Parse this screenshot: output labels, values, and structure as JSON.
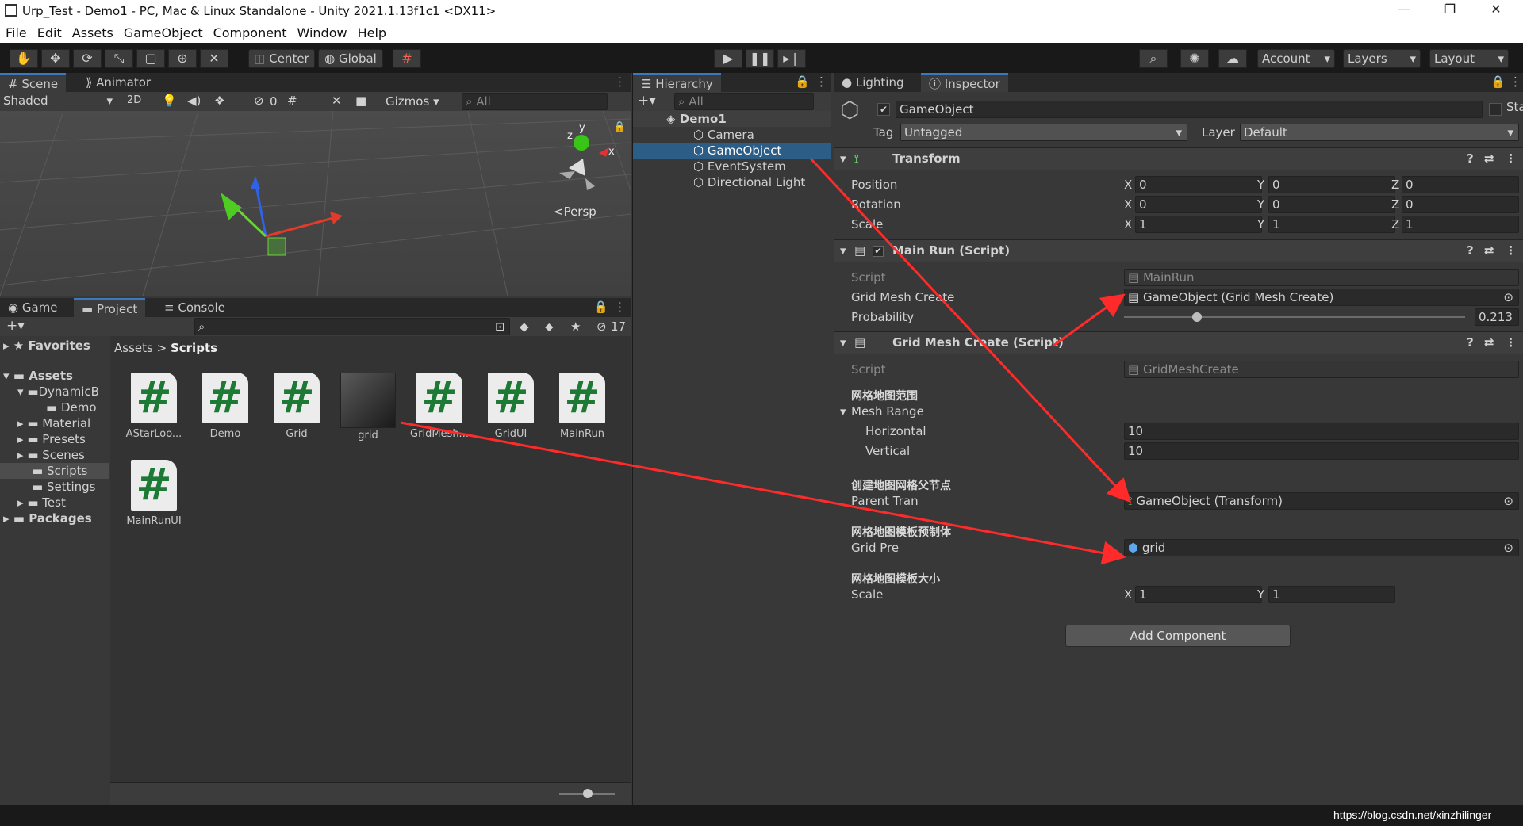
{
  "window": {
    "title": "Urp_Test - Demo1 - PC, Mac & Linux Standalone - Unity 2021.1.13f1c1 <DX11>",
    "minimize": "—",
    "maximize": "❐",
    "close": "✕"
  },
  "menu": [
    "File",
    "Edit",
    "Assets",
    "GameObject",
    "Component",
    "Window",
    "Help"
  ],
  "toolbar": {
    "center": "Center",
    "global": "Global",
    "account": "Account",
    "layers": "Layers",
    "layout": "Layout"
  },
  "scene": {
    "tab_scene": "Scene",
    "tab_animator": "Animator",
    "shaded": "Shaded",
    "mode_2d": "2D",
    "hidden_count": "0",
    "gizmos": "Gizmos",
    "search_placeholder": "All",
    "persp": "<Persp",
    "gizmo_x": "x",
    "gizmo_y": "y",
    "gizmo_z": "z"
  },
  "project": {
    "tab_game": "Game",
    "tab_project": "Project",
    "tab_console": "Console",
    "hidden_count": "17",
    "favorites": "Favorites",
    "assets": "Assets",
    "tree": [
      "DynamicB",
      "Demo",
      "Material",
      "Presets",
      "Scenes",
      "Scripts",
      "Settings",
      "Test"
    ],
    "packages": "Packages",
    "breadcrumb_root": "Assets",
    "breadcrumb_sep": ">",
    "breadcrumb_leaf": "Scripts",
    "files": [
      "AStarLoo...",
      "Demo",
      "Grid",
      "grid",
      "GridMesh...",
      "GridUI",
      "MainRun",
      "MainRunUI"
    ]
  },
  "hierarchy": {
    "tab": "Hierarchy",
    "search_placeholder": "All",
    "scene": "Demo1",
    "items": [
      "Camera",
      "GameObject",
      "EventSystem",
      "Directional Light"
    ]
  },
  "inspector": {
    "tab_lighting": "Lighting",
    "tab_inspector": "Inspector",
    "object_name": "GameObject",
    "static": "Static",
    "tag_label": "Tag",
    "tag_value": "Untagged",
    "layer_label": "Layer",
    "layer_value": "Default",
    "transform": {
      "title": "Transform",
      "position": "Position",
      "rotation": "Rotation",
      "scale": "Scale",
      "x": "X",
      "y": "Y",
      "z": "Z",
      "pos": [
        "0",
        "0",
        "0"
      ],
      "rot": [
        "0",
        "0",
        "0"
      ],
      "scl": [
        "1",
        "1",
        "1"
      ]
    },
    "mainrun": {
      "title": "Main Run (Script)",
      "script_label": "Script",
      "script_value": "MainRun",
      "gmc_label": "Grid Mesh Create",
      "gmc_value": "GameObject (Grid Mesh Create)",
      "prob_label": "Probability",
      "prob_value": "0.213",
      "prob_fraction": 0.213
    },
    "gridmesh": {
      "title": "Grid Mesh Create (Script)",
      "script_label": "Script",
      "script_value": "GridMeshCreate",
      "range_header": "网格地图范围",
      "mesh_range": "Mesh Range",
      "horizontal": "Horizontal",
      "horizontal_value": "10",
      "vertical": "Vertical",
      "vertical_value": "10",
      "parent_header": "创建地图网格父节点",
      "parent_label": "Parent Tran",
      "parent_value": "GameObject (Transform)",
      "pre_header": "网格地图模板预制体",
      "pre_label": "Grid Pre",
      "pre_value": "grid",
      "size_header": "网格地图模板大小",
      "scale_label": "Scale",
      "x": "X",
      "y": "Y",
      "scale_x": "1",
      "scale_y": "1"
    },
    "add_component": "Add Component"
  },
  "watermark": "https://blog.csdn.net/xinzhilinger",
  "colors": {
    "accent": "#3a79bb",
    "selection": "#2c5d87",
    "arrow": "#ff2a2a"
  }
}
